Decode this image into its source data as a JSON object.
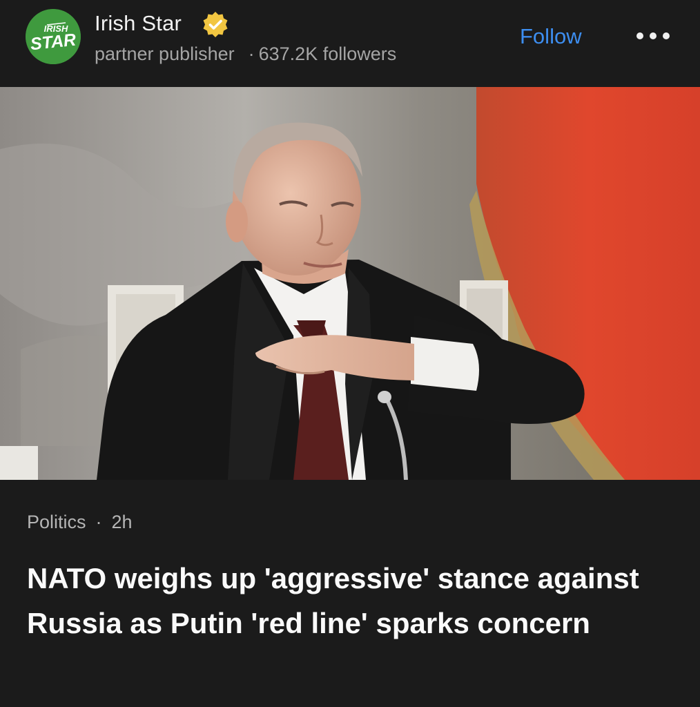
{
  "publisher": {
    "name": "Irish Star",
    "logo_text": [
      "IRISH",
      "STAR"
    ],
    "verified": true,
    "role": "partner publisher",
    "followers": "637.2K followers",
    "follow_label": "Follow"
  },
  "article": {
    "category": "Politics",
    "time_ago": "2h",
    "headline": "NATO weighs up 'aggressive' stance against Russia as Putin 'red line' sparks concern"
  },
  "colors": {
    "background": "#1b1b1b",
    "accent": "#3d8ef0",
    "logo_green": "#3f9a3e",
    "badge_gold": "#f2c641"
  },
  "icons": {
    "verified": "verified-badge-icon",
    "more": "more-options-icon"
  }
}
